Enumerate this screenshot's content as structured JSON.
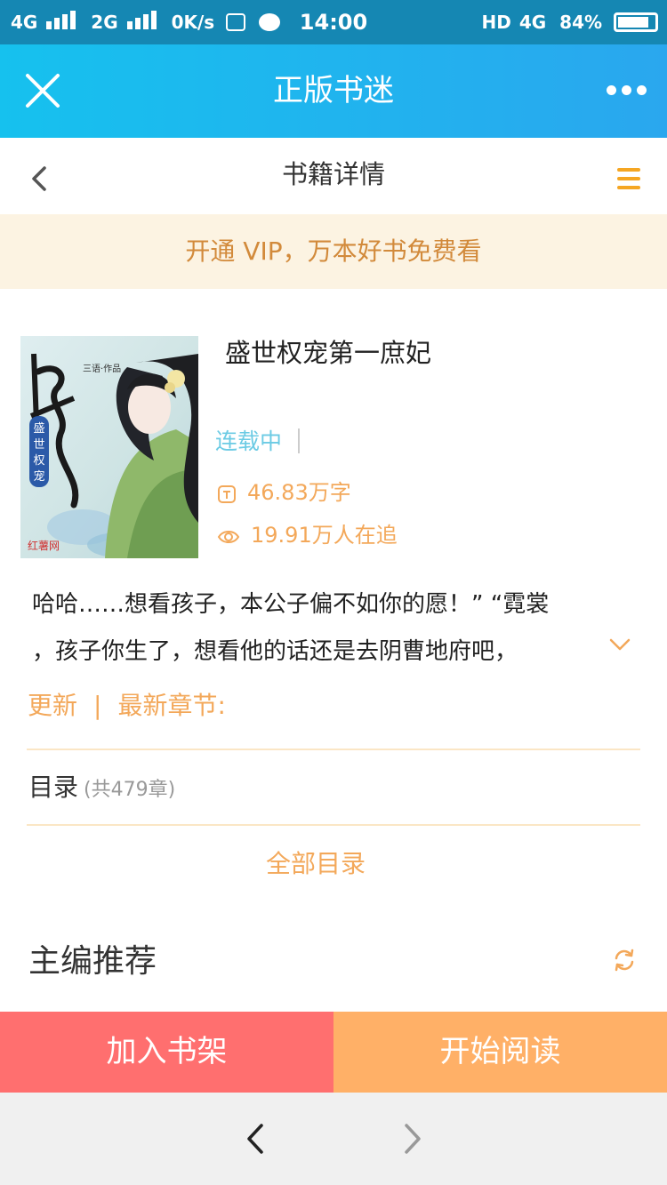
{
  "status_bar": {
    "network1": "4G",
    "network2": "2G",
    "speed": "0K/s",
    "time": "14:00",
    "hd": "HD",
    "network3": "4G",
    "battery": "84%",
    "battery_level": 0.84
  },
  "app_bar": {
    "title": "正版书迷"
  },
  "header": {
    "title": "书籍详情"
  },
  "vip_banner": {
    "text": "开通 VIP，万本好书免费看"
  },
  "book": {
    "title": "盛世权宠第一庶妃",
    "status": "连载中",
    "word_count": "46.83万字",
    "followers": "19.91万人在追",
    "cover_title": "第一庶妃",
    "cover_subtitle": "盛世权宠",
    "cover_author": "三语·作品",
    "cover_publisher": "红薯网"
  },
  "description": {
    "line1": "哈哈……想看孩子，本公子偏不如你的愿！”  “霓裳",
    "line2": "，孩子你生了，想看他的话还是去阴曹地府吧，"
  },
  "update": {
    "label": "更新",
    "separator": "|",
    "latest_label": "最新章节:"
  },
  "catalog": {
    "label": "目录",
    "count": "(共479章)",
    "all_label": "全部目录"
  },
  "recommend": {
    "title": "主编推荐"
  },
  "actions": {
    "add_shelf": "加入书架",
    "start_reading": "开始阅读"
  },
  "colors": {
    "app_bar": "#16c1ee",
    "accent": "#f3a85a",
    "vip_bg": "#fcf3e2",
    "shelf_button": "#ff6f6f",
    "read_button": "#ffb067"
  }
}
